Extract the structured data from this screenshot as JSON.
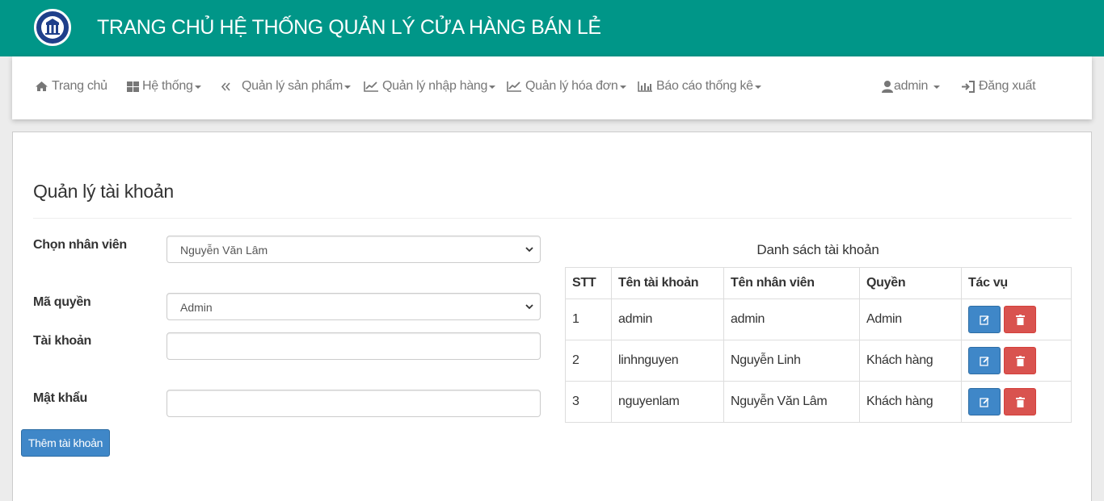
{
  "header": {
    "title": "TRANG CHỦ HỆ THỐNG QUẢN LÝ CỬA HÀNG BÁN LẺ"
  },
  "nav": {
    "items": [
      {
        "label": "Trang chủ",
        "icon": "home-icon",
        "caret": false
      },
      {
        "label": "Hệ thống",
        "icon": "grid-icon",
        "caret": true
      },
      {
        "label": "Quản lý sản phẩm",
        "icon": "code-icon",
        "caret": true
      },
      {
        "label": "Quản lý nhập hàng",
        "icon": "trend-icon",
        "caret": true
      },
      {
        "label": "Quản lý hóa đơn",
        "icon": "trend-icon",
        "caret": true
      },
      {
        "label": "Báo cáo thống kê",
        "icon": "bar-chart-icon",
        "caret": true
      }
    ],
    "user": "admin",
    "logout": "Đăng xuất"
  },
  "page": {
    "title": "Quản lý tài khoản"
  },
  "form": {
    "employee_label": "Chọn nhân viên",
    "employee_value": "Nguyễn Văn Lâm",
    "role_label": "Mã quyền",
    "role_value": "Admin",
    "account_label": "Tài khoản",
    "account_value": "",
    "password_label": "Mật khẩu",
    "password_value": "",
    "add_button": "Thêm tài khoản"
  },
  "table": {
    "caption": "Danh sách tài khoản",
    "headers": [
      "STT",
      "Tên tài khoản",
      "Tên nhân viên",
      "Quyền",
      "Tác vụ"
    ],
    "rows": [
      [
        "1",
        "admin",
        "admin",
        "Admin"
      ],
      [
        "2",
        "linhnguyen",
        "Nguyễn Linh",
        "Khách hàng"
      ],
      [
        "3",
        "nguyenlam",
        "Nguyễn Văn Lâm",
        "Khách hàng"
      ]
    ]
  },
  "colors": {
    "header_bg": "#009688",
    "primary": "#3f87c8",
    "danger": "#d9534f"
  }
}
